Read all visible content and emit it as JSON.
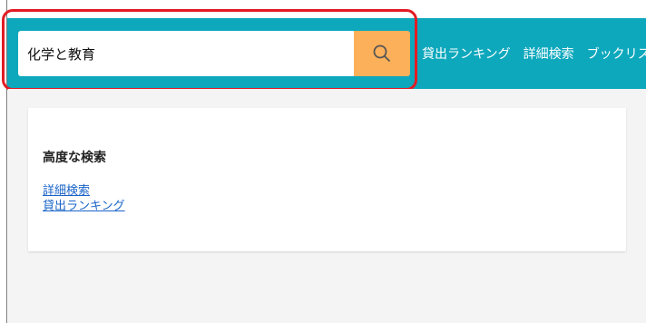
{
  "search": {
    "value": "化学と教育"
  },
  "nav": {
    "items": [
      "貸出ランキング",
      "詳細検索",
      "ブックリスト"
    ]
  },
  "card": {
    "title": "高度な検索",
    "links": [
      "詳細検索",
      "貸出ランキング"
    ]
  },
  "colors": {
    "header": "#0ea8bd",
    "search_button": "#fdb05a",
    "highlight": "#e21b24",
    "link": "#1a64c8"
  },
  "icons": {
    "search_button": "search-icon"
  }
}
